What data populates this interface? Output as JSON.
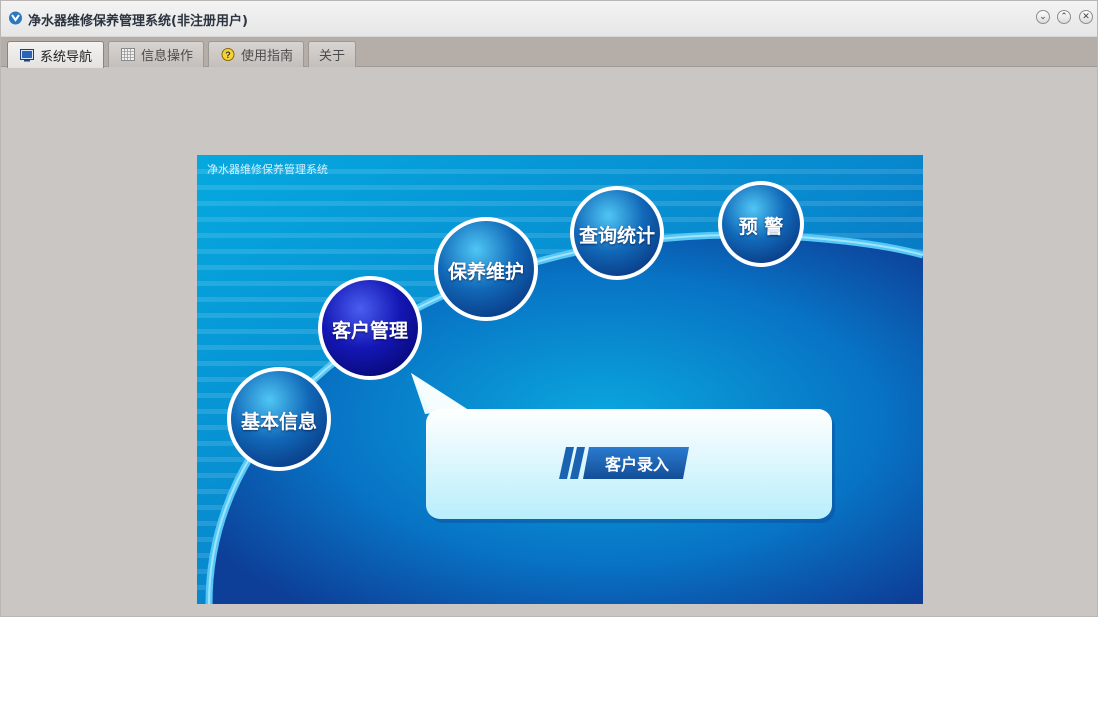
{
  "window": {
    "title": "净水器维修保养管理系统(非注册用户)",
    "icon": "app-logo-icon",
    "controls": [
      "minimize-icon",
      "maximize-icon",
      "close-icon"
    ]
  },
  "tabs": [
    {
      "label": "系统导航",
      "icon": "monitor-icon",
      "active": true
    },
    {
      "label": "信息操作",
      "icon": "grid-icon",
      "active": false
    },
    {
      "label": "使用指南",
      "icon": "help-icon",
      "active": false
    },
    {
      "label": "关于",
      "icon": "",
      "active": false
    }
  ],
  "nav_panel": {
    "title": "净水器维修保养管理系统",
    "modules": [
      {
        "label": "基本信息"
      },
      {
        "label": "客户管理",
        "selected": true
      },
      {
        "label": "保养维护"
      },
      {
        "label": "查询统计"
      },
      {
        "label": "预 警"
      }
    ],
    "callout": {
      "button_label": "客户录入"
    }
  },
  "colors": {
    "panel_blue": "#0a6fc2",
    "selected_module": "#1216a8",
    "callout_bg": "#d9f6fc",
    "action_button": "#1a5ea8"
  }
}
